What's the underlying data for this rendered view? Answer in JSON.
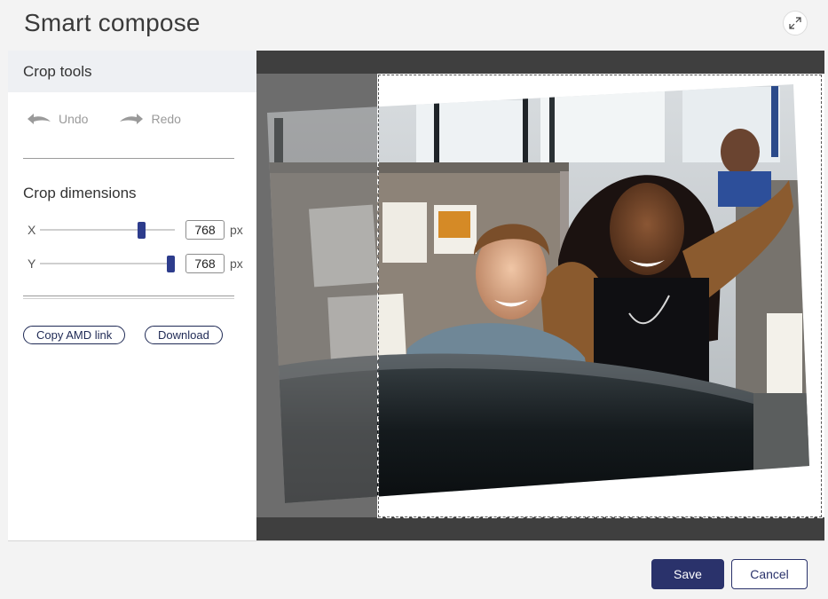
{
  "header": {
    "title": "Smart compose",
    "expand_icon": "expand-icon"
  },
  "sidebar": {
    "title": "Crop tools",
    "undo_label": "Undo",
    "redo_label": "Redo",
    "crop_dimensions_title": "Crop dimensions",
    "x": {
      "label": "X",
      "value": "768",
      "unit": "px",
      "slider_level": 0.75
    },
    "y": {
      "label": "Y",
      "value": "768",
      "unit": "px",
      "slider_level": 0.97
    },
    "copy_link_label": "Copy AMD link",
    "download_label": "Download"
  },
  "footer": {
    "save_label": "Save",
    "cancel_label": "Cancel"
  },
  "colors": {
    "accent": "#2a326b",
    "thumb": "#2d3c8c",
    "canvas_bg": "#3f3f3f"
  }
}
